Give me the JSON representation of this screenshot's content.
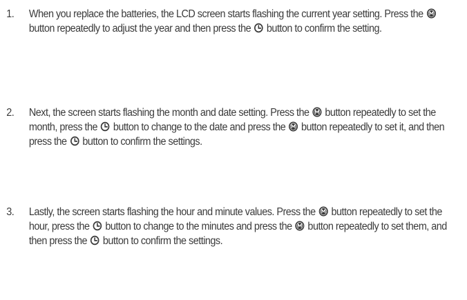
{
  "steps": [
    {
      "number": "1.",
      "segments": [
        {
          "type": "text",
          "value": "When you replace the batteries, the LCD screen starts flashing the current year setting. Press the "
        },
        {
          "type": "icon",
          "icon": "mode-m-icon"
        },
        {
          "type": "text",
          "value": " button repeatedly to adjust the year and then press the "
        },
        {
          "type": "icon",
          "icon": "clock-icon"
        },
        {
          "type": "text",
          "value": " button to confirm the setting."
        }
      ]
    },
    {
      "number": "2.",
      "segments": [
        {
          "type": "text",
          "value": "Next, the screen starts flashing the month and date setting. Press the "
        },
        {
          "type": "icon",
          "icon": "mode-m-icon"
        },
        {
          "type": "text",
          "value": " button repeatedly to set the month, press the "
        },
        {
          "type": "icon",
          "icon": "clock-icon"
        },
        {
          "type": "text",
          "value": " button to change to the date and press the "
        },
        {
          "type": "icon",
          "icon": "mode-m-icon"
        },
        {
          "type": "text",
          "value": " button repeatedly to set it, and then press the "
        },
        {
          "type": "icon",
          "icon": "clock-icon"
        },
        {
          "type": "text",
          "value": " button to confirm the settings."
        }
      ]
    },
    {
      "number": "3.",
      "segments": [
        {
          "type": "text",
          "value": "Lastly, the screen starts flashing the hour and minute values. Press the "
        },
        {
          "type": "icon",
          "icon": "mode-m-icon"
        },
        {
          "type": "text",
          "value": " button repeatedly to set the hour, press the "
        },
        {
          "type": "icon",
          "icon": "clock-icon"
        },
        {
          "type": "text",
          "value": " button to change to the minutes and press the "
        },
        {
          "type": "icon",
          "icon": "mode-m-icon"
        },
        {
          "type": "text",
          "value": " button repeatedly to set them, and then press the "
        },
        {
          "type": "icon",
          "icon": "clock-icon"
        },
        {
          "type": "text",
          "value": " button to confirm the settings."
        }
      ]
    }
  ],
  "colors": {
    "text": "#3a3a3a",
    "background": "#ffffff"
  }
}
